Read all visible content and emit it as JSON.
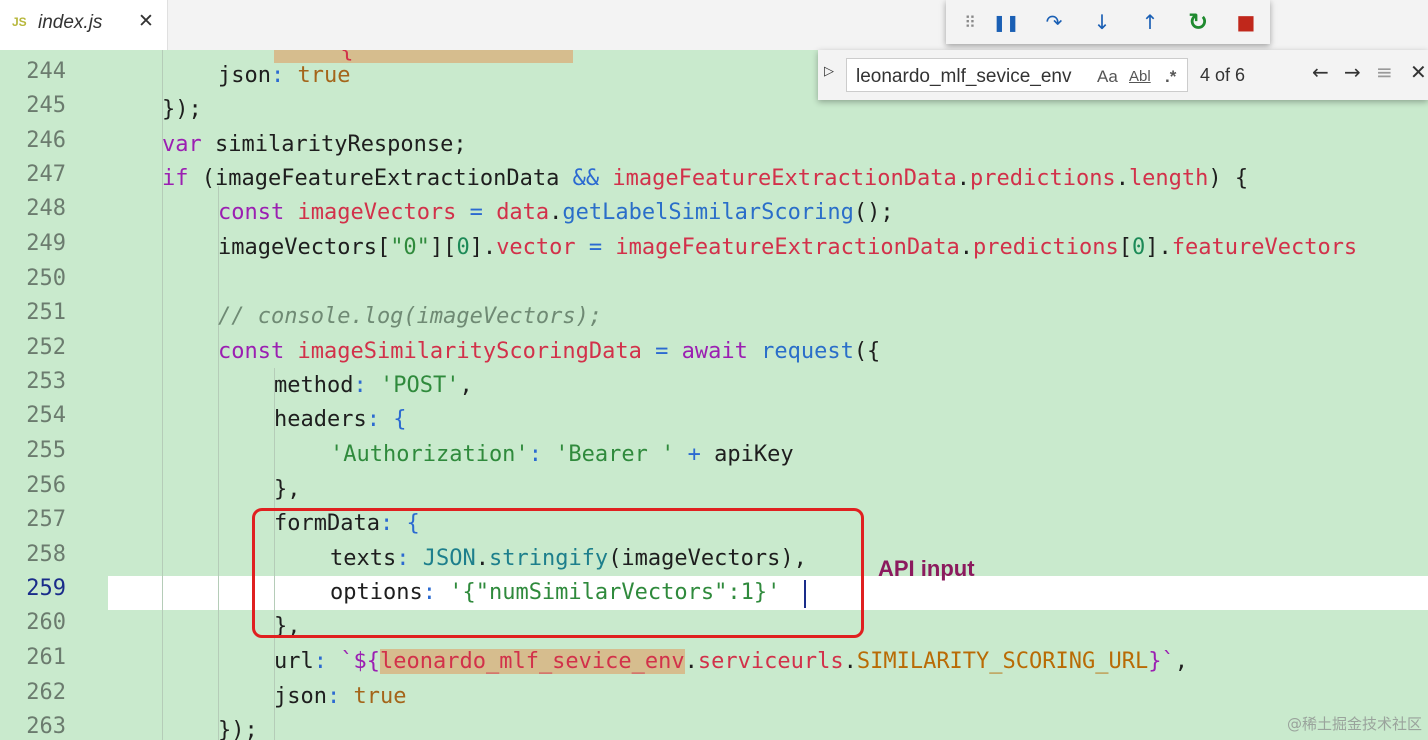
{
  "tab": {
    "icon": "JS",
    "file_name": "index.js",
    "close": "✕"
  },
  "debug_toolbar": {
    "grip": "⠿",
    "pause": "❚❚",
    "step_over": "↷",
    "step_into": "↓",
    "step_out": "↑",
    "restart": "↻",
    "stop": "■"
  },
  "find": {
    "toggle": "▷",
    "query": "leonardo_mlf_sevice_env",
    "match_case": "Aa",
    "whole_word": "Abl",
    "regex": ".*",
    "count": "4 of 6",
    "prev": "←",
    "next": "→",
    "selection": "≡",
    "close": "✕"
  },
  "line_numbers": [
    "244",
    "245",
    "246",
    "247",
    "248",
    "249",
    "250",
    "251",
    "252",
    "253",
    "254",
    "255",
    "256",
    "257",
    "258",
    "259",
    "260",
    "261",
    "262",
    "263"
  ],
  "active_line": "259",
  "code": {
    "l243_partial": "    '{",
    "l244": [
      "json",
      ": ",
      "true"
    ],
    "l245": "});",
    "l246": [
      "var",
      " similarityResponse;"
    ],
    "l247": [
      "if",
      " (imageFeatureExtractionData ",
      "&&",
      " ",
      "imageFeatureExtractionData",
      ".",
      "predictions",
      ".",
      "length",
      ") {"
    ],
    "l248": [
      "const",
      " ",
      "imageVectors",
      " = ",
      "data",
      ".",
      "getLabelSimilarScoring",
      "();"
    ],
    "l249": [
      "imageVectors[",
      "\"0\"",
      "][",
      "0",
      "].",
      "vector",
      " = ",
      "imageFeatureExtractionData",
      ".",
      "predictions",
      "[",
      "0",
      "].",
      "featureVectors"
    ],
    "l251": "// console.log(imageVectors);",
    "l252": [
      "const",
      " ",
      "imageSimilarityScoringData",
      " = ",
      "await",
      " ",
      "request",
      "({"
    ],
    "l253": [
      "method",
      ": ",
      "'POST'",
      ","
    ],
    "l254": [
      "headers",
      ": {"
    ],
    "l255": [
      "'Authorization'",
      ": ",
      "'Bearer '",
      " + ",
      "apiKey"
    ],
    "l256": "},",
    "l257": [
      "formData",
      ": {"
    ],
    "l258": [
      "texts",
      ": ",
      "JSON",
      ".",
      "stringify",
      "(imageVectors),"
    ],
    "l259": [
      "options",
      ": ",
      "'{\"numSimilarVectors\":1}'"
    ],
    "l260": "},",
    "l261": [
      "url",
      ": ",
      "`${",
      "leonardo_mlf_sevice_env",
      ".",
      "serviceurls",
      ".",
      "SIMILARITY_SCORING_URL",
      "}`",
      ","
    ],
    "l262": [
      "json",
      ": ",
      "true"
    ],
    "l263": "});"
  },
  "annotation": "API input",
  "watermark": "@稀土掘金技术社区"
}
